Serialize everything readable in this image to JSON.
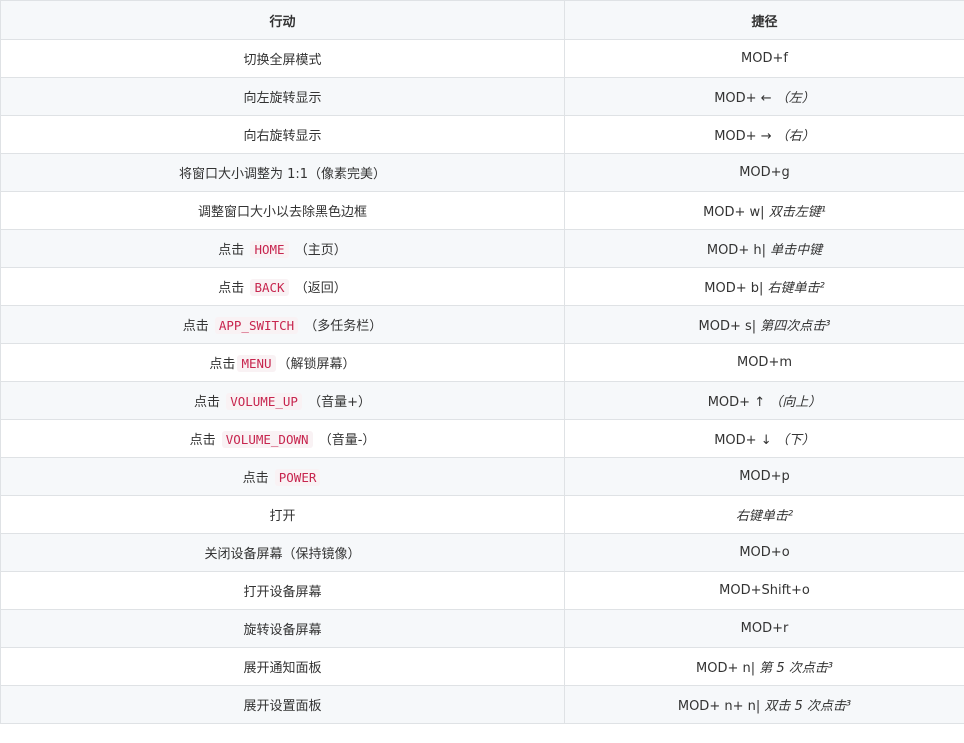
{
  "header": {
    "action": "行动",
    "shortcut": "捷径"
  },
  "rows": [
    {
      "a_pre": "切换全屏模式",
      "a_code": "",
      "a_post": "",
      "k_text": "MOD+f",
      "k_note": ""
    },
    {
      "a_pre": "向左旋转显示",
      "a_code": "",
      "a_post": "",
      "k_text": "MOD+ ←",
      "k_note": "（左）"
    },
    {
      "a_pre": "向右旋转显示",
      "a_code": "",
      "a_post": "",
      "k_text": "MOD+ →",
      "k_note": "（右）"
    },
    {
      "a_pre": "将窗口大小调整为 1:1（像素完美）",
      "a_code": "",
      "a_post": "",
      "k_text": "MOD+g",
      "k_note": ""
    },
    {
      "a_pre": "调整窗口大小以去除黑色边框",
      "a_code": "",
      "a_post": "",
      "k_text": "MOD+ w|",
      "k_note": "双击左键¹"
    },
    {
      "a_pre": "点击",
      "a_code": "HOME",
      "a_post": "（主页）",
      "k_text": "MOD+ h|",
      "k_note": "单击中键"
    },
    {
      "a_pre": "点击",
      "a_code": "BACK",
      "a_post": "（返回）",
      "k_text": "MOD+ b|",
      "k_note": "右键单击²"
    },
    {
      "a_pre": "点击",
      "a_code": "APP_SWITCH",
      "a_post": "（多任务栏）",
      "k_text": "MOD+ s|",
      "k_note": "第四次点击³"
    },
    {
      "a_pre": "点击",
      "a_code": "MENU",
      "a_post": "（解锁屏幕）",
      "k_text": "MOD+m",
      "k_note": ""
    },
    {
      "a_pre": "点击",
      "a_code": "VOLUME_UP",
      "a_post": "（音量+）",
      "k_text": "MOD+ ↑",
      "k_note": "（向上）"
    },
    {
      "a_pre": "点击",
      "a_code": "VOLUME_DOWN",
      "a_post": "（音量-）",
      "k_text": "MOD+ ↓",
      "k_note": "（下）"
    },
    {
      "a_pre": "点击",
      "a_code": "POWER",
      "a_post": "",
      "k_text": "MOD+p",
      "k_note": ""
    },
    {
      "a_pre": "打开",
      "a_code": "",
      "a_post": "",
      "k_text": "",
      "k_note": "右键单击²"
    },
    {
      "a_pre": "关闭设备屏幕（保持镜像）",
      "a_code": "",
      "a_post": "",
      "k_text": "MOD+o",
      "k_note": ""
    },
    {
      "a_pre": "打开设备屏幕",
      "a_code": "",
      "a_post": "",
      "k_text": "MOD+Shift+o",
      "k_note": ""
    },
    {
      "a_pre": "旋转设备屏幕",
      "a_code": "",
      "a_post": "",
      "k_text": "MOD+r",
      "k_note": ""
    },
    {
      "a_pre": "展开通知面板",
      "a_code": "",
      "a_post": "",
      "k_text": "MOD+ n|",
      "k_note": "第 5 次点击³"
    },
    {
      "a_pre": "展开设置面板",
      "a_code": "",
      "a_post": "",
      "k_text": "MOD+ n+ n|",
      "k_note": "双击 5 次点击³"
    }
  ]
}
